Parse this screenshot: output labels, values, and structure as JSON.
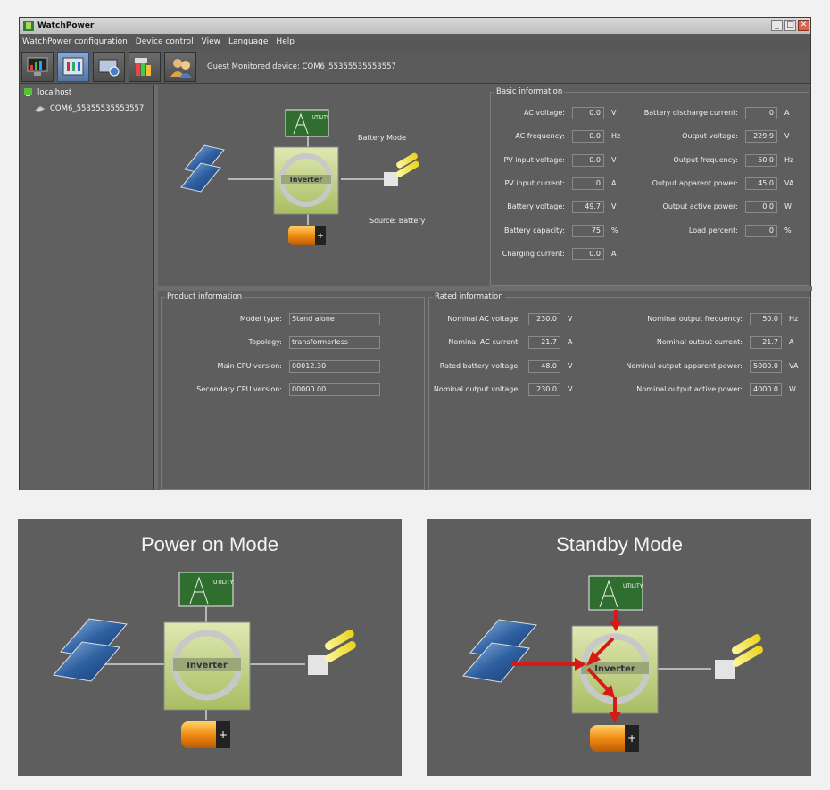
{
  "window": {
    "title": "WatchPower"
  },
  "menu": [
    "WatchPower configuration",
    "Device control",
    "View",
    "Language",
    "Help"
  ],
  "toolbar": {
    "status": "Guest   Monitored device:  COM6_55355535553557"
  },
  "tree": {
    "root": "localhost",
    "device": "COM6_55355535553557"
  },
  "diagram": {
    "mode": "Battery Mode",
    "source": "Source:  Battery",
    "inverter": "Inverter",
    "utility": "UTILITY"
  },
  "basic": {
    "title": "Basic information",
    "left": [
      {
        "label": "AC voltage:",
        "value": "0.0",
        "unit": "V"
      },
      {
        "label": "AC frequency:",
        "value": "0.0",
        "unit": "Hz"
      },
      {
        "label": "PV input voltage:",
        "value": "0.0",
        "unit": "V"
      },
      {
        "label": "PV input current:",
        "value": "0",
        "unit": "A"
      },
      {
        "label": "Battery voltage:",
        "value": "49.7",
        "unit": "V"
      },
      {
        "label": "Battery capacity:",
        "value": "75",
        "unit": "%"
      },
      {
        "label": "Charging current:",
        "value": "0.0",
        "unit": "A"
      }
    ],
    "right": [
      {
        "label": "Battery discharge current:",
        "value": "0",
        "unit": "A"
      },
      {
        "label": "Output voltage:",
        "value": "229.9",
        "unit": "V"
      },
      {
        "label": "Output frequency:",
        "value": "50.0",
        "unit": "Hz"
      },
      {
        "label": "Output apparent power:",
        "value": "45.0",
        "unit": "VA"
      },
      {
        "label": "Output active power:",
        "value": "0.0",
        "unit": "W"
      },
      {
        "label": "Load percent:",
        "value": "0",
        "unit": "%"
      }
    ]
  },
  "product": {
    "title": "Product information",
    "rows": [
      {
        "label": "Model type:",
        "value": "Stand alone"
      },
      {
        "label": "Topology:",
        "value": "transformerless"
      },
      {
        "label": "Main CPU version:",
        "value": "00012.30"
      },
      {
        "label": "Secondary CPU version:",
        "value": "00000.00"
      }
    ]
  },
  "rated": {
    "title": "Rated information",
    "left": [
      {
        "label": "Nominal AC voltage:",
        "value": "230.0",
        "unit": "V"
      },
      {
        "label": "Nominal AC current:",
        "value": "21.7",
        "unit": "A"
      },
      {
        "label": "Rated battery voltage:",
        "value": "48.0",
        "unit": "V"
      },
      {
        "label": "Nominal output voltage:",
        "value": "230.0",
        "unit": "V"
      }
    ],
    "right": [
      {
        "label": "Nominal output frequency:",
        "value": "50.0",
        "unit": "Hz"
      },
      {
        "label": "Nominal output current:",
        "value": "21.7",
        "unit": "A"
      },
      {
        "label": "Nominal output apparent power:",
        "value": "5000.0",
        "unit": "VA"
      },
      {
        "label": "Nominal output active power:",
        "value": "4000.0",
        "unit": "W"
      }
    ]
  },
  "modes": {
    "power_on": {
      "title": "Power on Mode",
      "inverter": "Inverter",
      "utility": "UTILITY"
    },
    "standby": {
      "title": "Standby Mode",
      "inverter": "Inverter",
      "utility": "UTILITY"
    }
  },
  "colors": {
    "window_bg": "#5e5e5e",
    "border": "#7c7c7c",
    "inverter": "#b9cc7a",
    "arrow": "#d61a1a",
    "utility": "#2f6e2f"
  }
}
